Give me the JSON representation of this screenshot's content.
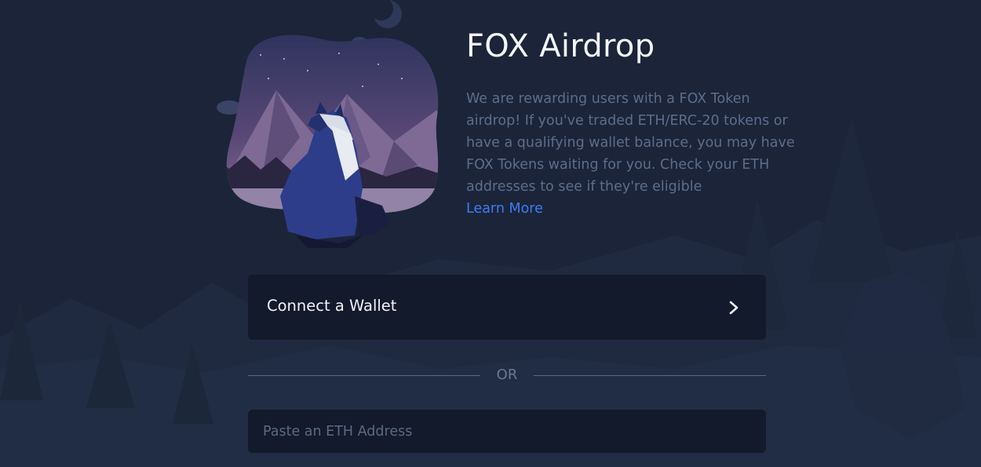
{
  "app": {
    "title": "FOX Airdrop",
    "description": "We are rewarding users with a FOX Token airdrop! If you've traded ETH/ERC-20 tokens or have a qualifying wallet balance, you may have FOX Tokens waiting for you. Check your ETH addresses to see if they're eligible",
    "learn_more_label": "Learn More"
  },
  "connect": {
    "label": "Connect a Wallet",
    "icon": "chevron-right-icon"
  },
  "divider": {
    "label": "OR"
  },
  "address_input": {
    "value": "",
    "placeholder": "Paste an ETH Address"
  },
  "colors": {
    "background": "#1b2438",
    "panel": "#121a2b",
    "accent_link": "#3d7cf6",
    "title_text": "#f3f5f9",
    "muted_text": "#5d6d8c"
  },
  "icons": {
    "hero": "fox-mountain-illustration",
    "moon": "crescent-moon-icon"
  }
}
